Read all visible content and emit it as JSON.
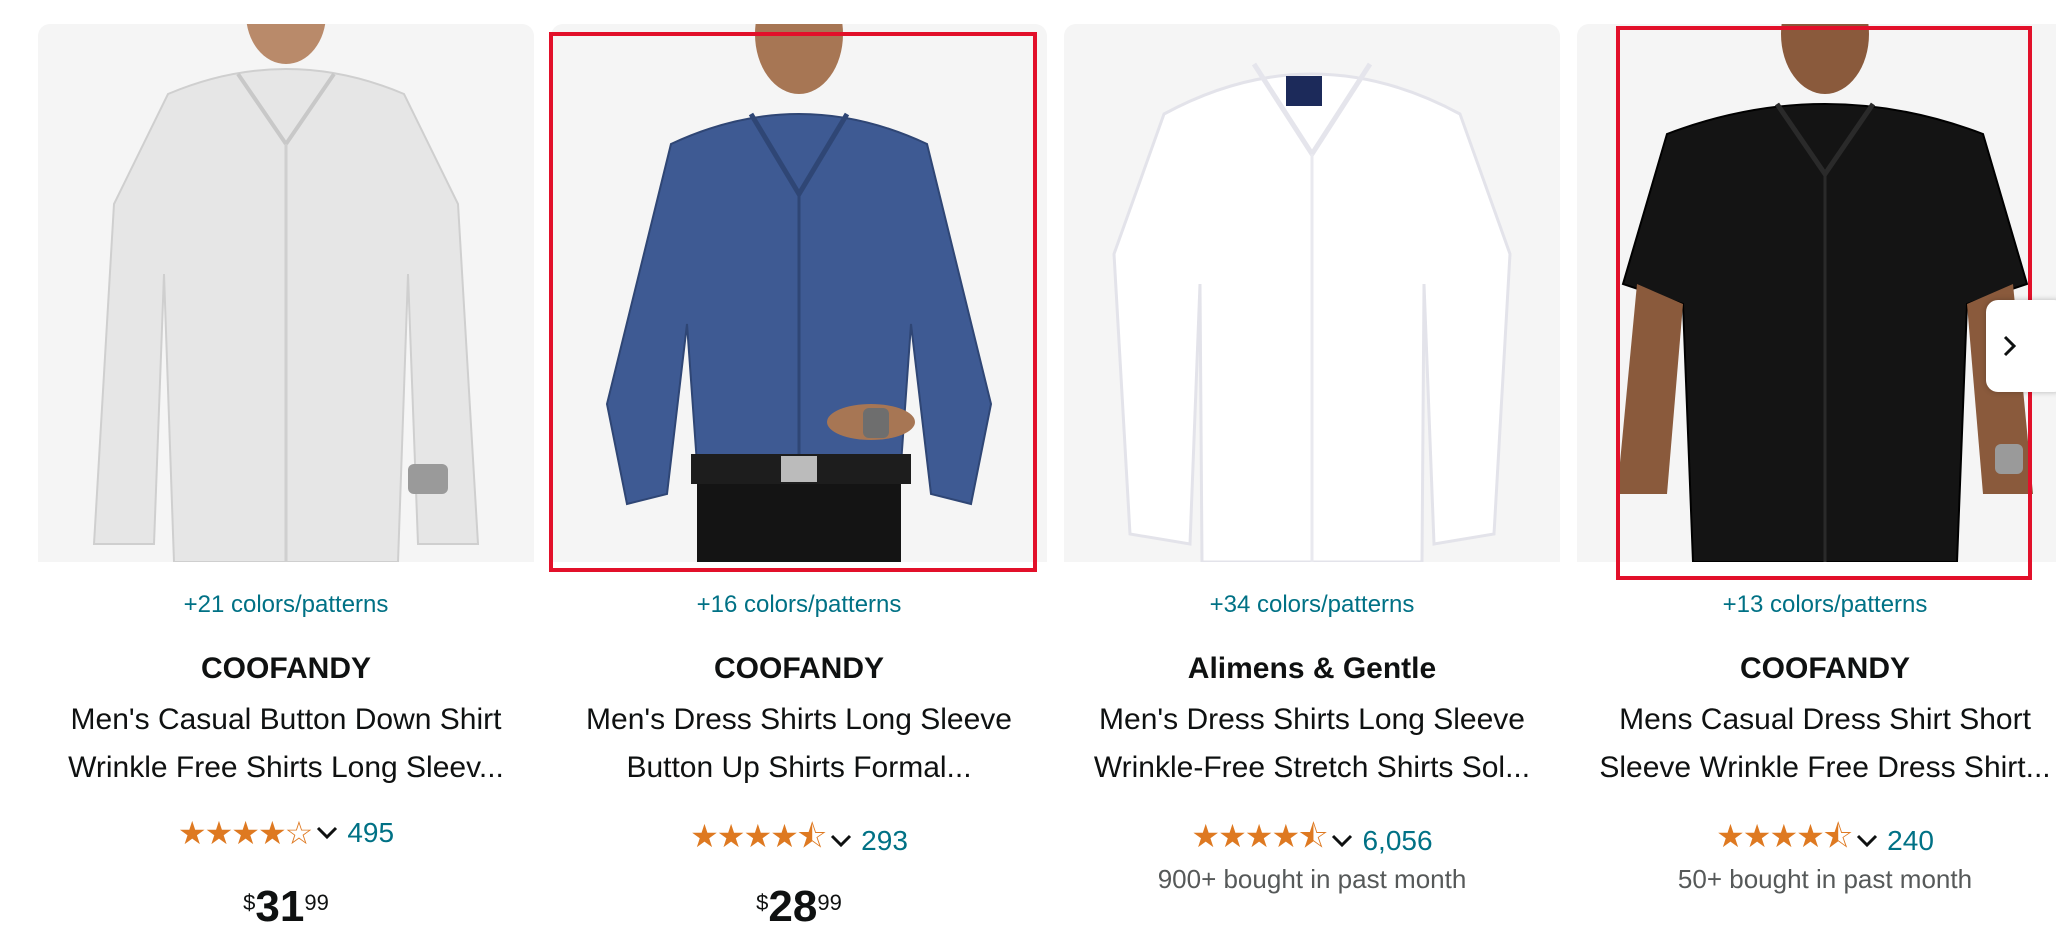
{
  "products": [
    {
      "colors": "+21 colors/patterns",
      "brand": "COOFANDY",
      "title_line1": "Men's Casual Button Down Shirt",
      "title_line2": "Wrinkle Free Shirts Long Sleev...",
      "stars": "★★★★☆",
      "rating_value": 4.0,
      "reviews": "495",
      "bought": "",
      "price_symbol": "$",
      "price_whole": "31",
      "price_fraction": "99",
      "shirt_color": "#e7e7e7",
      "icon": "chevron-down-icon"
    },
    {
      "colors": "+16 colors/patterns",
      "brand": "COOFANDY",
      "title_line1": "Men's Dress Shirts Long Sleeve",
      "title_line2": "Button Up Shirts Formal...",
      "stars": "★★★★⯪",
      "rating_value": 4.5,
      "reviews": "293",
      "bought": "",
      "price_symbol": "$",
      "price_whole": "28",
      "price_fraction": "99",
      "shirt_color": "#3e5a93",
      "icon": "chevron-down-icon"
    },
    {
      "colors": "+34 colors/patterns",
      "brand": "Alimens & Gentle",
      "title_line1": "Men's Dress Shirts Long Sleeve",
      "title_line2": "Wrinkle-Free Stretch Shirts Sol...",
      "stars": "★★★★⯪",
      "rating_value": 4.5,
      "reviews": "6,056",
      "bought": "900+ bought in past month",
      "shirt_color": "#fbfbfd",
      "icon": "chevron-down-icon"
    },
    {
      "colors": "+13 colors/patterns",
      "brand": "COOFANDY",
      "title_line1": "Mens Casual Dress Shirt Short",
      "title_line2": "Sleeve Wrinkle Free Dress Shirt...",
      "stars": "★★★★⯪",
      "rating_value": 4.5,
      "reviews": "240",
      "bought": "50+ bought in past month",
      "shirt_color": "#141414",
      "icon": "chevron-down-icon"
    }
  ],
  "highlight_color": "#e2102a",
  "star_color": "#de7921",
  "link_color": "#007185"
}
